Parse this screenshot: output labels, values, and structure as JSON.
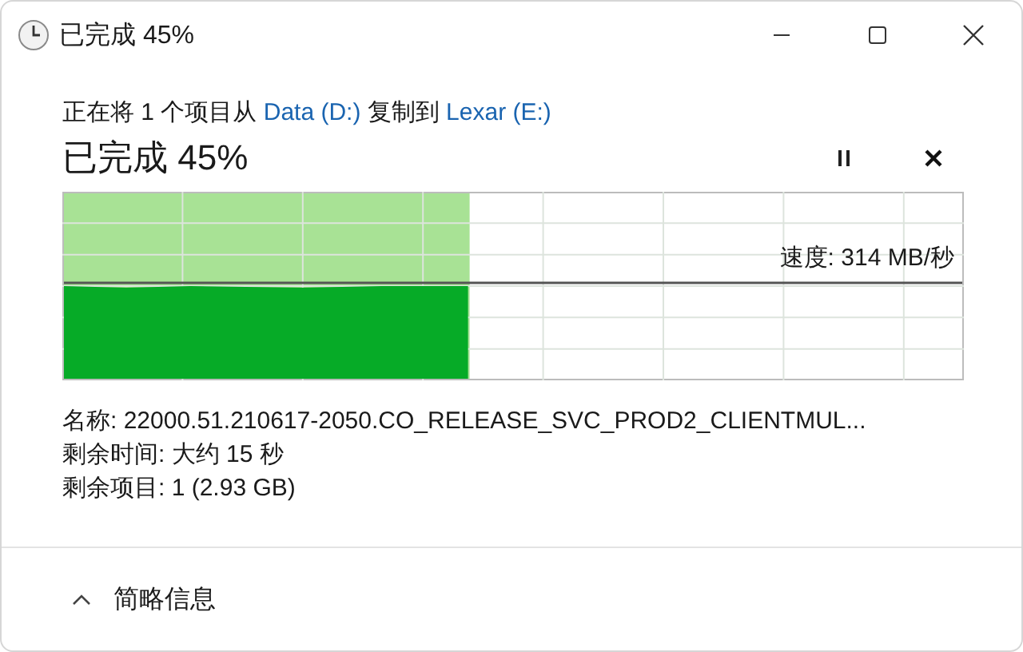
{
  "window": {
    "title": "已完成 45%"
  },
  "description": [
    {
      "kind": "text",
      "text": "正在将 1 个项目从 "
    },
    {
      "kind": "link",
      "text": "Data (D:)"
    },
    {
      "kind": "text",
      "text": " 复制到 "
    },
    {
      "kind": "link",
      "text": "Lexar (E:)"
    }
  ],
  "heading": "已完成 45%",
  "progress": {
    "level": 0.45,
    "speed": "速度: 314 MB/秒"
  },
  "details": [
    "名称: 22000.51.210617-2050.CO_RELEASE_SVC_PROD2_CLIENTMUL...",
    "剩余时间: 大约 15 秒",
    "剩余项目: 1 (2.93 GB)"
  ],
  "footer": {
    "label": "简略信息",
    "expanded": true
  }
}
